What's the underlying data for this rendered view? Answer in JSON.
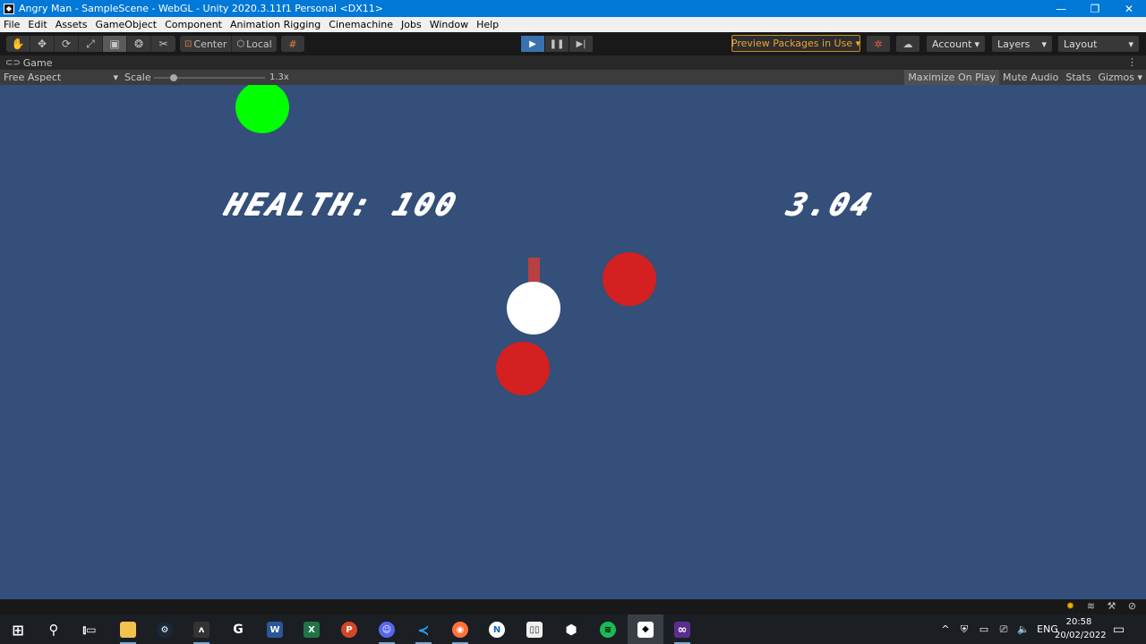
{
  "titlebar": {
    "title": "Angry Man - SampleScene - WebGL - Unity 2020.3.11f1 Personal <DX11>",
    "minimize": "—",
    "maximize": "❐",
    "close": "✕"
  },
  "menu": [
    "File",
    "Edit",
    "Assets",
    "GameObject",
    "Component",
    "Animation Rigging",
    "Cinemachine",
    "Jobs",
    "Window",
    "Help"
  ],
  "toolbar": {
    "tools": [
      {
        "name": "hand-tool",
        "glyph": "✋"
      },
      {
        "name": "move-tool",
        "glyph": "✥"
      },
      {
        "name": "rotate-tool",
        "glyph": "⟳"
      },
      {
        "name": "scale-tool",
        "glyph": "⤢"
      },
      {
        "name": "rect-tool",
        "glyph": "▣"
      },
      {
        "name": "transform-tool",
        "glyph": "❂"
      },
      {
        "name": "custom-tool",
        "glyph": "✂"
      }
    ],
    "pivot_center": "Center",
    "pivot_local": "Local",
    "preview_packages": "Preview Packages in Use ▾",
    "account": "Account",
    "layers": "Layers",
    "layout": "Layout",
    "accent_color": "#3a72b0",
    "warning_color": "#e8a43a"
  },
  "game_tab": {
    "label": "Game",
    "aspect": "Free Aspect",
    "scale_label": "Scale",
    "scale_value": "1.3x",
    "scale_fraction": 0.18,
    "maximize_on_play": "Maximize On Play",
    "mute_audio": "Mute Audio",
    "stats": "Stats",
    "gizmos": "Gizmos"
  },
  "game": {
    "background_color": "#334f7a",
    "health_text": "HEALTH: 100",
    "timer_text": "3.04",
    "colors": {
      "pickup": "#00ff00",
      "player": "#ffffff",
      "enemy": "#d42020"
    }
  },
  "taskbar": {
    "apps": [
      "start",
      "search",
      "task-view",
      "file-explorer",
      "steam",
      "predator",
      "g-hub",
      "word",
      "excel",
      "powerpoint",
      "discord",
      "vscode",
      "firefox",
      "notion",
      "twitch",
      "unity-hub",
      "spotify",
      "unity",
      "visual-studio"
    ],
    "language": "ENG",
    "time": "20:58",
    "date": "20/02/2022"
  }
}
